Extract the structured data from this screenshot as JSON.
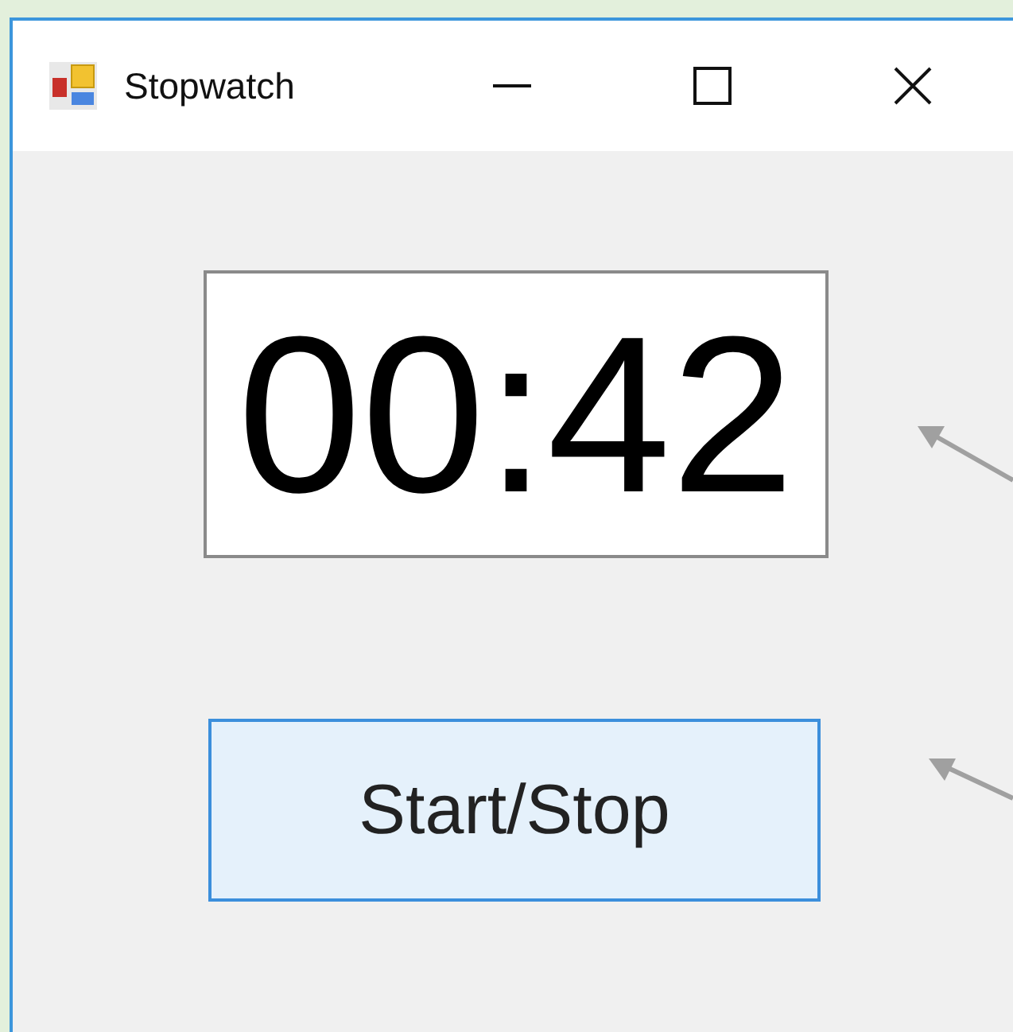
{
  "window": {
    "title": "Stopwatch"
  },
  "timer_display": "00:42",
  "start_stop_button": "Start/Stop"
}
